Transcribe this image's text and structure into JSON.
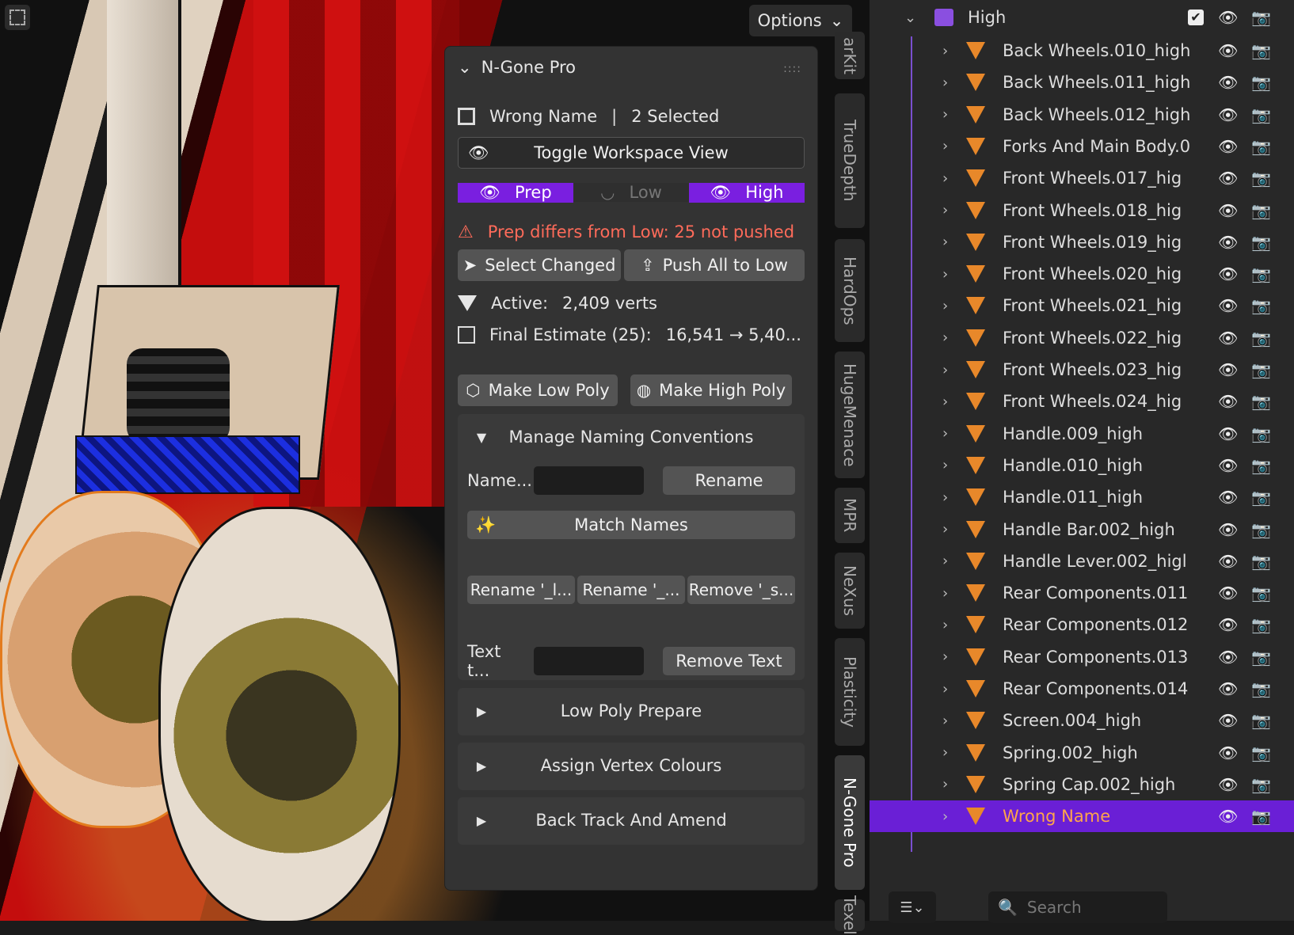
{
  "viewport": {
    "options_label": "Options"
  },
  "tabs": [
    "arKit",
    "TrueDepth",
    "HardOps",
    "HugeMenace",
    "MPR",
    "NeXus",
    "Plasticity",
    "N-Gone Pro",
    "Texel"
  ],
  "panel": {
    "title": "N-Gone Pro",
    "object_name": "Wrong Name",
    "selected_text": "2 Selected",
    "toggle_workspace": "Toggle Workspace View",
    "prep": "Prep",
    "low": "Low",
    "high": "High",
    "warning": "Prep differs from Low: 25 not pushed",
    "select_changed": "Select Changed",
    "push_all": "Push All to Low",
    "active_label": "Active:",
    "active_value": "2,409 verts",
    "final_label": "Final Estimate (25):",
    "final_value": "16,541 → 5,40...",
    "make_low": "Make Low Poly",
    "make_high": "Make High Poly",
    "naming": {
      "title": "Manage Naming Conventions",
      "name_label": "Name...",
      "rename": "Rename",
      "match_names": "Match Names",
      "rename_l": "Rename '_l...",
      "rename_u": "Rename '_...",
      "remove_s": "Remove '_s...",
      "text_label": "Text t...",
      "remove_text": "Remove Text"
    },
    "sections": [
      "Low Poly Prepare",
      "Assign Vertex Colours",
      "Back Track And Amend"
    ]
  },
  "outliner": {
    "collection": "High",
    "items": [
      "Back Wheels.010_high",
      "Back Wheels.011_high",
      "Back Wheels.012_high",
      "Forks And Main Body.0",
      "Front Wheels.017_hig",
      "Front Wheels.018_hig",
      "Front Wheels.019_hig",
      "Front Wheels.020_hig",
      "Front Wheels.021_hig",
      "Front Wheels.022_hig",
      "Front Wheels.023_hig",
      "Front Wheels.024_hig",
      "Handle.009_high",
      "Handle.010_high",
      "Handle.011_high",
      "Handle Bar.002_high",
      "Handle Lever.002_higl",
      "Rear Components.011",
      "Rear Components.012",
      "Rear Components.013",
      "Rear Components.014",
      "Screen.004_high",
      "Spring.002_high",
      "Spring Cap.002_high",
      "Wrong Name"
    ],
    "search_placeholder": "Search"
  },
  "colors": {
    "accent": "#7a1fe0",
    "warning": "#ff6b5a",
    "mesh_icon": "#e8882a"
  }
}
